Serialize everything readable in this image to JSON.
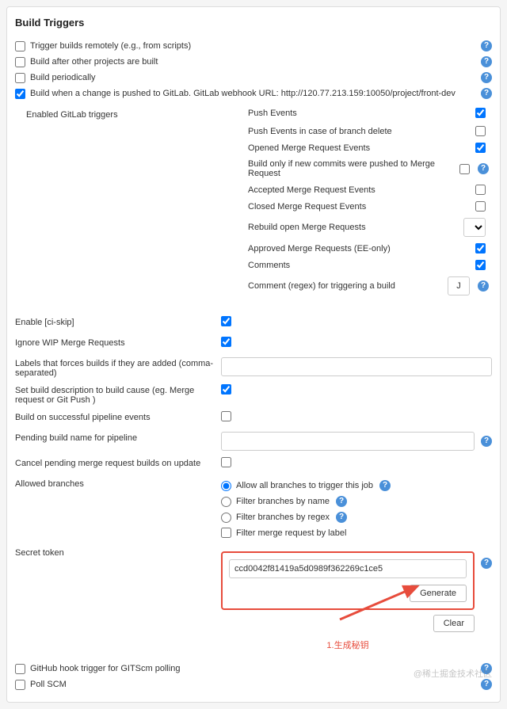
{
  "section_title": "Build Triggers",
  "triggers": {
    "remote": {
      "label": "Trigger builds remotely (e.g., from scripts)",
      "checked": false
    },
    "after_other": {
      "label": "Build after other projects are built",
      "checked": false
    },
    "periodic": {
      "label": "Build periodically",
      "checked": false
    },
    "gitlab": {
      "label": "Build when a change is pushed to GitLab. GitLab webhook URL: http://120.77.213.159:10050/project/front-dev",
      "checked": true
    }
  },
  "gitlab": {
    "enabled_label": "Enabled GitLab triggers",
    "items": {
      "push": {
        "label": "Push Events",
        "checked": true
      },
      "push_delete": {
        "label": "Push Events in case of branch delete",
        "checked": false
      },
      "opened_mr": {
        "label": "Opened Merge Request Events",
        "checked": true
      },
      "build_only_new": {
        "label": "Build only if new commits were pushed to Merge Request",
        "checked": false,
        "help": true
      },
      "accepted_mr": {
        "label": "Accepted Merge Request Events",
        "checked": false
      },
      "closed_mr": {
        "label": "Closed Merge Request Events",
        "checked": false
      },
      "rebuild_open": {
        "label": "Rebuild open Merge Requests",
        "type": "select"
      },
      "approved_mr": {
        "label": "Approved Merge Requests (EE-only)",
        "checked": true
      },
      "comments": {
        "label": "Comments",
        "checked": true
      },
      "comment_regex": {
        "label": "Comment (regex) for triggering a build",
        "value": "J",
        "help": true
      }
    }
  },
  "fields": {
    "ci_skip": {
      "label": "Enable [ci-skip]",
      "checked": true
    },
    "ignore_wip": {
      "label": "Ignore WIP Merge Requests",
      "checked": true
    },
    "labels": {
      "label": "Labels that forces builds if they are added (comma-separated)",
      "value": ""
    },
    "build_desc": {
      "label": "Set build description to build cause (eg. Merge request or Git Push )",
      "checked": true
    },
    "success_pipeline": {
      "label": "Build on successful pipeline events",
      "checked": false
    },
    "pending_name": {
      "label": "Pending build name for pipeline",
      "value": "",
      "help": true
    },
    "cancel_pending": {
      "label": "Cancel pending merge request builds on update",
      "checked": false
    },
    "allowed_branches": {
      "label": "Allowed branches",
      "options": {
        "all": {
          "label": "Allow all branches to trigger this job",
          "selected": true
        },
        "by_name": {
          "label": "Filter branches by name",
          "selected": false
        },
        "by_regex": {
          "label": "Filter branches by regex",
          "selected": false
        },
        "by_label": {
          "label": "Filter merge request by label",
          "selected": false
        }
      }
    },
    "secret_token": {
      "label": "Secret token",
      "value": "ccd0042f81419a5d0989f362269c1ce5",
      "generate": "Generate",
      "clear": "Clear"
    }
  },
  "annotation": "1.生成秘钥",
  "bottom": {
    "github_hook": {
      "label": "GitHub hook trigger for GITScm polling",
      "checked": false
    },
    "poll_scm": {
      "label": "Poll SCM",
      "checked": false
    }
  },
  "watermark": "@稀土掘金技术社区"
}
